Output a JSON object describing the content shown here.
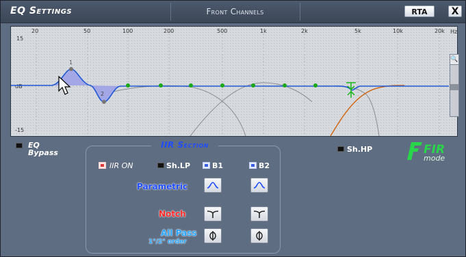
{
  "titlebar": {
    "title": "EQ Settings",
    "channel": "Front Channels",
    "rta_label": "RTA",
    "close_label": "X"
  },
  "graph": {
    "freq_ticks": [
      "20",
      "50",
      "100",
      "200",
      "500",
      "1k",
      "2k",
      "5k",
      "10k",
      "20k"
    ],
    "freq_unit": "Hz",
    "y_top": "15",
    "y_mid": "dB",
    "y_bottom": "-15",
    "point1_label": "1",
    "point2_label": "2"
  },
  "eq_bypass": {
    "line1": "EQ",
    "line2": "Bypass"
  },
  "iir": {
    "title": "IIR Section",
    "iir_on_label": "IIR ON",
    "sh_lp_label": "Sh.LP",
    "b1_label": "B1",
    "b2_label": "B2",
    "parametric_label": "Parametric",
    "notch_label": "Notch",
    "allpass_label": "All Pass",
    "allpass_sub": "1°/2° order"
  },
  "sh_hp_label": "Sh.HP",
  "fir_logo": {
    "text": "FIR",
    "sub": "mode"
  },
  "colors": {
    "accent_blue": "#1f4cff",
    "notch_red": "#ff2a2a",
    "allpass_blue": "#2aa6ff",
    "curve": "#1f5ad6",
    "point_green": "#1aa81a",
    "fir_green": "#29d64a"
  }
}
